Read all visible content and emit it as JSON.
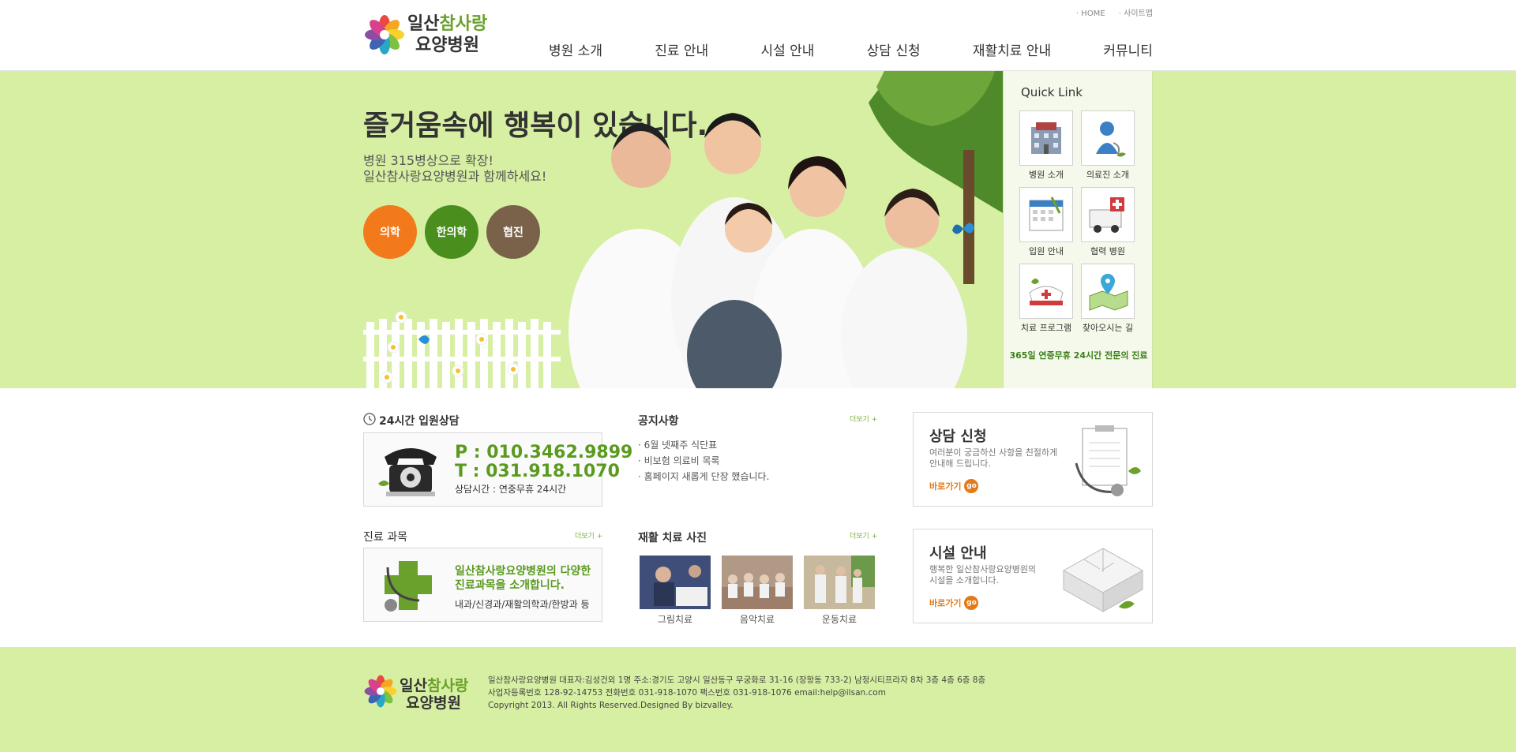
{
  "colors": {
    "accent_green": "#6aa12c",
    "banner_bg": "#d7efa3",
    "orange": "#f27a1a",
    "dark_green": "#4a8f1d",
    "brown": "#7a6149"
  },
  "logo": {
    "line1_a": "일산",
    "line1_b": "참사랑",
    "line2": "요양병원"
  },
  "topmini": {
    "home": "· HOME",
    "sitemap": "· 사이트맵"
  },
  "nav": [
    "병원 소개",
    "진료 안내",
    "시설 안내",
    "상담 신청",
    "재활치료 안내",
    "커뮤니티"
  ],
  "visual": {
    "headline": "즐거움속에 행복이 있습니다.",
    "sub1": "병원 315병상으로 확장!",
    "sub2": "일산참사랑요양병원과 함께하세요!",
    "circles": [
      "의학",
      "한의학",
      "협진"
    ]
  },
  "quick": {
    "title": "Quick Link",
    "items": [
      {
        "label": "병원 소개",
        "icon": "hospital-icon"
      },
      {
        "label": "의료진 소개",
        "icon": "doctor-icon"
      },
      {
        "label": "입원 안내",
        "icon": "calendar-icon"
      },
      {
        "label": "협력 병원",
        "icon": "ambulance-icon"
      },
      {
        "label": "치료 프로그램",
        "icon": "nurse-cap-icon"
      },
      {
        "label": "찾아오시는 길",
        "icon": "map-pin-icon"
      }
    ],
    "footer": "365일 연중무휴 24시간 전문의 진료"
  },
  "consult24": {
    "title": "24시간 입원상담",
    "phone_p": "P : 010.3462.9899",
    "phone_t": "T : 031.918.1070",
    "hours": "상담시간 : 연중무휴 24시간"
  },
  "notice": {
    "title": "공지사항",
    "more": "더보기 +",
    "items": [
      "· 6월 넷째주 식단표",
      "· 비보험 의료비 목록",
      "· 홈페이지 새롭게 단장 했습니다."
    ]
  },
  "dept": {
    "title": "진료 과목",
    "more": "더보기 +",
    "line1": "일산참사랑요양병원의 다양한",
    "line2": "진료과목을 소개합니다.",
    "line3": "내과/신경과/재활의학과/한방과 등"
  },
  "gallery": {
    "title": "재활 치료 사진",
    "more": "더보기 +",
    "items": [
      "그림치료",
      "음악치료",
      "운동치료"
    ]
  },
  "consult_box": {
    "title": "상담 신청",
    "desc1": "여러분이 궁금하신 사항을 친절하게",
    "desc2": "안내해 드립니다.",
    "go": "바로가기",
    "go_badge": "go"
  },
  "facility_box": {
    "title": "시설 안내",
    "desc1": "행복한 일산참사랑요양병원의",
    "desc2": "시설을 소개합니다.",
    "go": "바로가기",
    "go_badge": "go"
  },
  "footer": {
    "line1": "일산참사랑요양병원   대표자:김성건외 1명   주소:경기도 고양시 일산동구 무궁화로 31-16 (장항동 733-2) 남정시티프라자 8차 3층 4층 6층 8층",
    "line2": "사업자등록번호 128-92-14753   전화번호 031-918-1070   팩스번호 031-918-1076   email:help@ilsan.com",
    "line3": "Copyright 2013. All Rights Reserved.Designed By bizvalley."
  }
}
